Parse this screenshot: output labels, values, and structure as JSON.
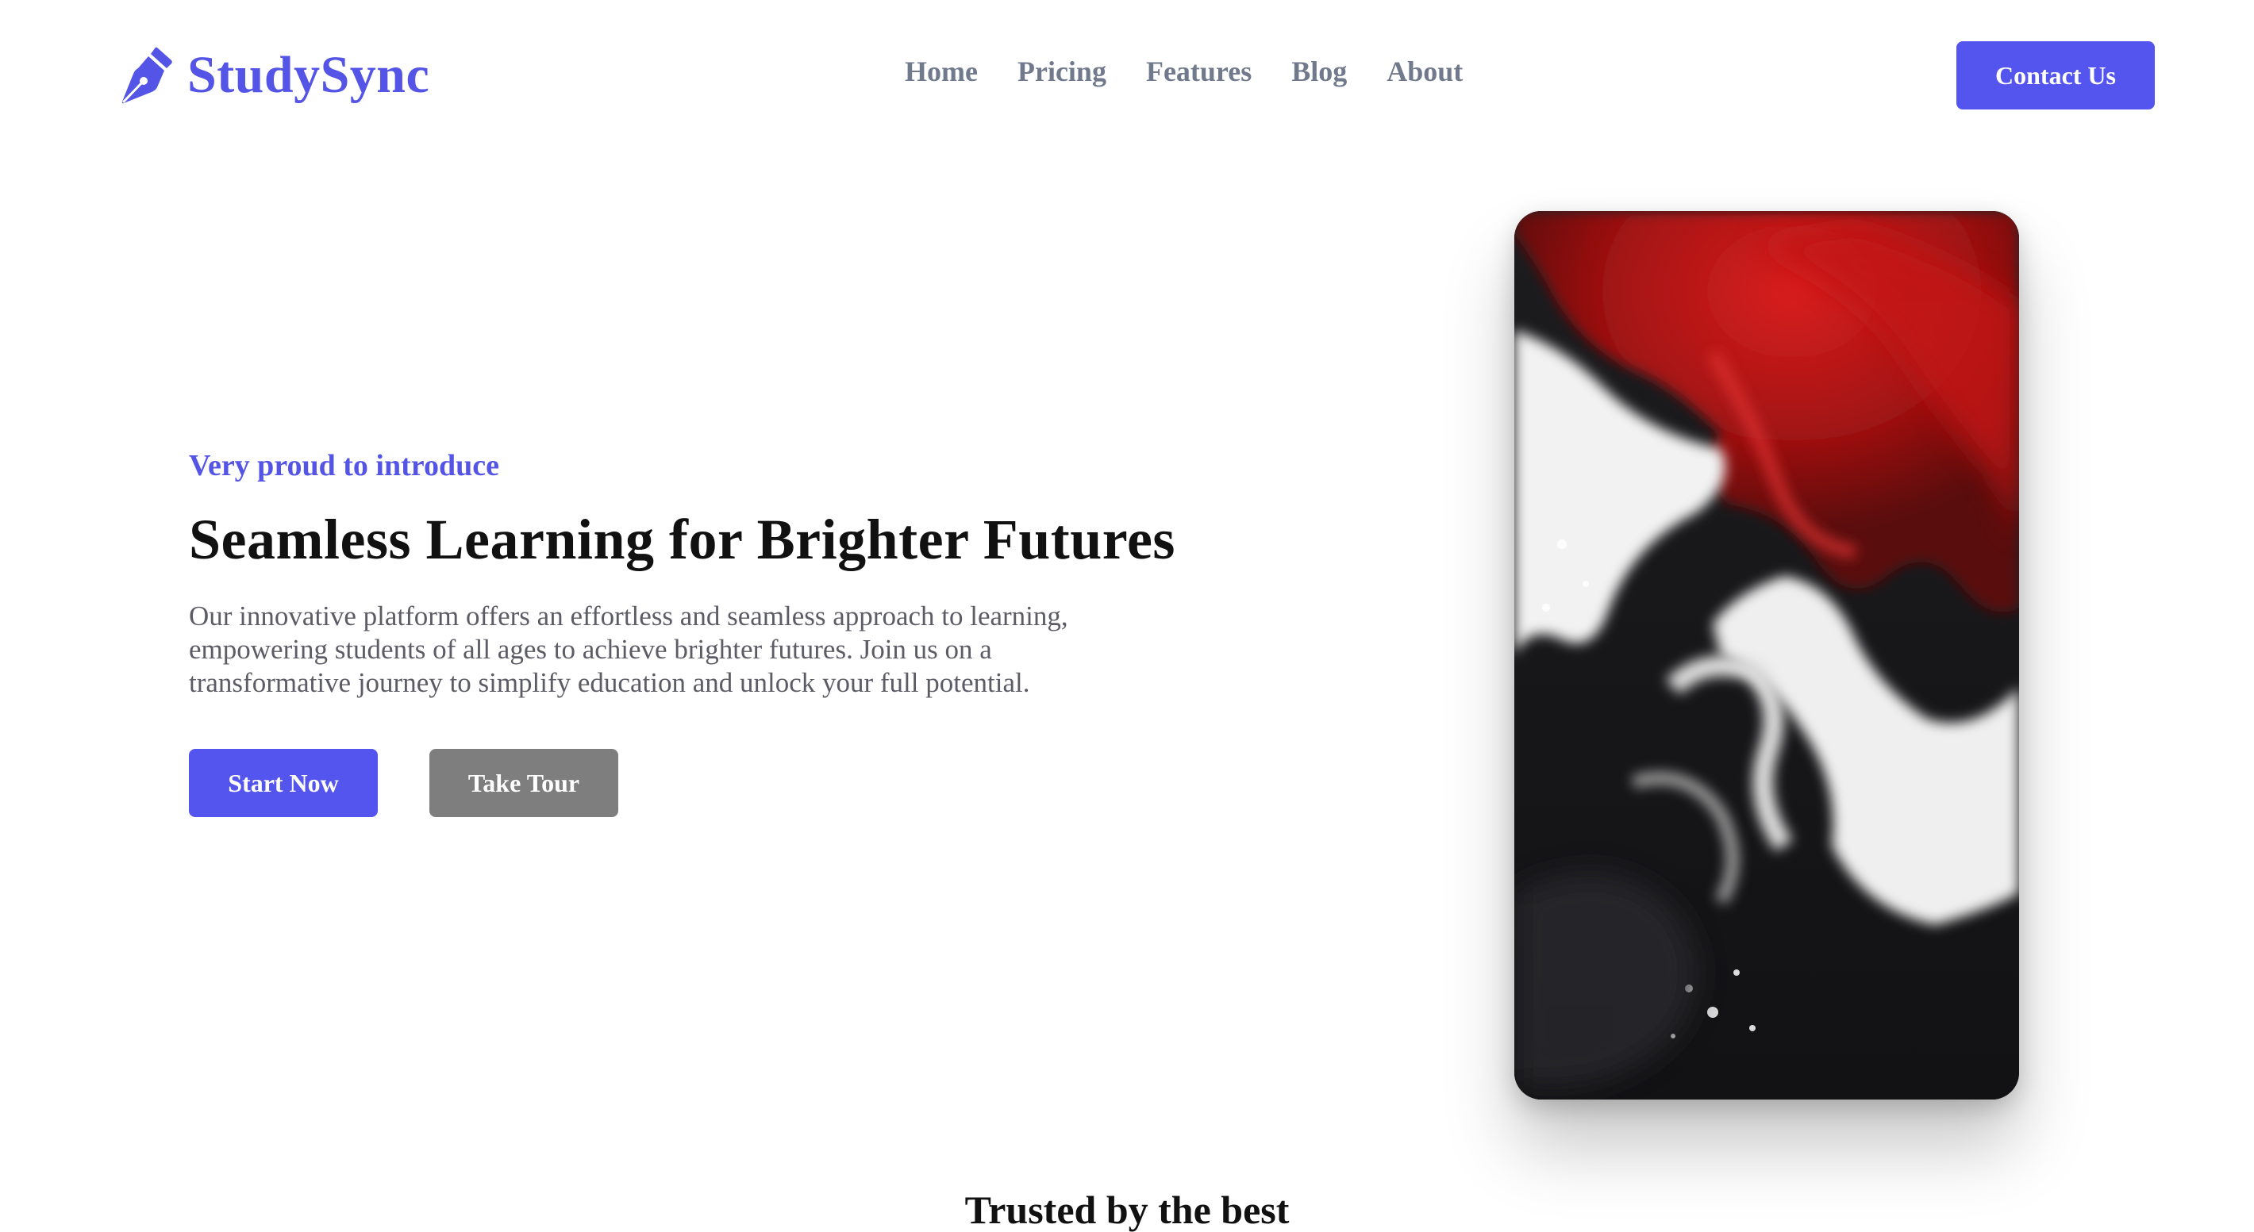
{
  "brand": {
    "name": "StudySync",
    "logo_icon": "fountain-pen-icon",
    "accent_color": "#5454E6"
  },
  "nav": {
    "items": [
      "Home",
      "Pricing",
      "Features",
      "Blog",
      "About"
    ]
  },
  "header": {
    "contact_label": "Contact Us"
  },
  "hero": {
    "eyebrow": "Very proud to introduce",
    "headline": "Seamless Learning for Brighter Futures",
    "description": "Our innovative platform offers an effortless and seamless approach to learning, empowering students of all ages to achieve brighter futures. Join us on a transformative journey to simplify education and unlock your full potential.",
    "primary_cta": "Start Now",
    "secondary_cta": "Take Tour"
  },
  "showcase": {
    "image": "red-white-black-fluid-ink-art"
  },
  "trusted": {
    "heading": "Trusted by the best"
  }
}
